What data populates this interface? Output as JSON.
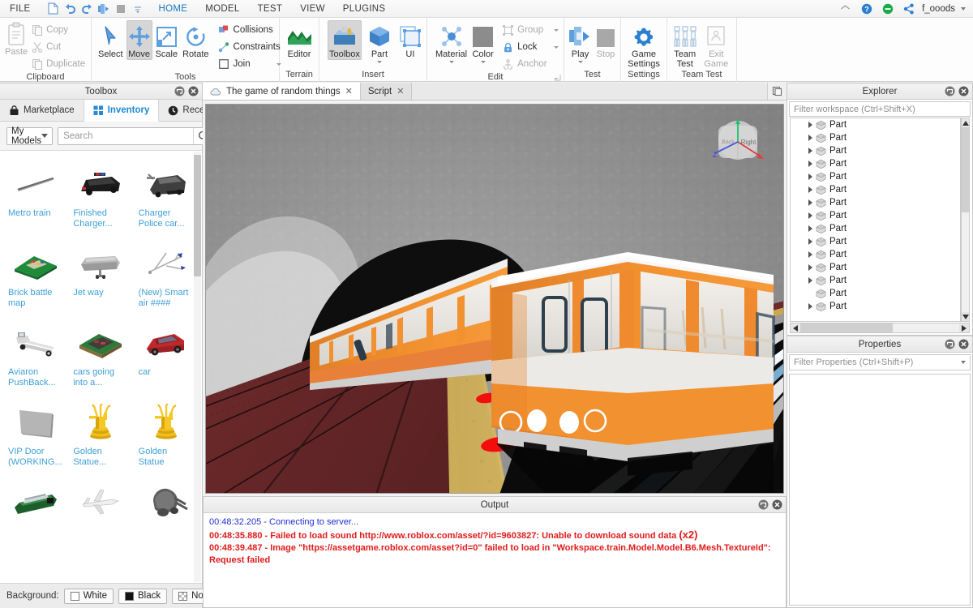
{
  "menubar": {
    "items": [
      {
        "label": "FILE",
        "active": false
      },
      {
        "label": "HOME",
        "active": true
      },
      {
        "label": "MODEL",
        "active": false
      },
      {
        "label": "TEST",
        "active": false
      },
      {
        "label": "VIEW",
        "active": false
      },
      {
        "label": "PLUGINS",
        "active": false
      }
    ],
    "quick_access": [
      "new-file-icon",
      "undo-icon",
      "redo-icon",
      "play-icon",
      "stop-icon",
      "qat-dropdown-icon"
    ],
    "account": {
      "name": "f_ooods",
      "icons": [
        "home-icon",
        "help-icon",
        "notification-icon",
        "share-icon"
      ]
    }
  },
  "ribbon": {
    "groups": [
      {
        "name": "Clipboard",
        "title": "Clipboard",
        "paste": {
          "label": "Paste",
          "disabled": true
        },
        "small": [
          {
            "label": "Copy",
            "icon": "copy-icon",
            "disabled": true
          },
          {
            "label": "Cut",
            "icon": "cut-icon",
            "disabled": true
          },
          {
            "label": "Duplicate",
            "icon": "duplicate-icon",
            "disabled": true
          }
        ]
      },
      {
        "name": "Tools",
        "title": "Tools",
        "buttons": [
          {
            "label": "Select",
            "icon": "cursor-icon",
            "selected": false
          },
          {
            "label": "Move",
            "icon": "move-arrows-icon",
            "selected": true
          },
          {
            "label": "Scale",
            "icon": "scale-icon",
            "selected": false
          },
          {
            "label": "Rotate",
            "icon": "rotate-icon",
            "selected": false
          }
        ],
        "small": [
          {
            "label": "Collisions",
            "icon": "collisions-icon"
          },
          {
            "label": "Constraints",
            "icon": "constraints-icon"
          },
          {
            "label": "Join",
            "icon": "join-checkbox-icon",
            "caret": true
          }
        ]
      },
      {
        "name": "Terrain",
        "title": "Terrain",
        "buttons": [
          {
            "label": "Editor",
            "icon": "terrain-editor-icon",
            "selected": false
          }
        ]
      },
      {
        "name": "Insert",
        "title": "Insert",
        "buttons": [
          {
            "label": "Toolbox",
            "icon": "toolbox-icon",
            "selected": true
          },
          {
            "label": "Part",
            "icon": "part-cube-icon",
            "caret": true
          },
          {
            "label": "UI",
            "icon": "ui-frame-icon"
          }
        ]
      },
      {
        "name": "Edit",
        "title": "Edit",
        "buttons": [
          {
            "label": "Material",
            "icon": "material-icon",
            "caret": true
          },
          {
            "label": "Color",
            "icon": "color-swatch-icon",
            "caret": true
          }
        ],
        "small": [
          {
            "label": "Group",
            "icon": "group-icon",
            "disabled": true,
            "caret": true
          },
          {
            "label": "Lock",
            "icon": "lock-icon",
            "disabled": false,
            "caret": true
          },
          {
            "label": "Anchor",
            "icon": "anchor-icon",
            "disabled": true
          }
        ]
      },
      {
        "name": "Test",
        "title": "Test",
        "buttons": [
          {
            "label": "Play",
            "icon": "play-run-icon",
            "caret": true
          },
          {
            "label": "Stop",
            "icon": "stop-square-icon",
            "disabled": true
          }
        ]
      },
      {
        "name": "Settings",
        "title": "Settings",
        "buttons": [
          {
            "label": "Game",
            "label2": "Settings",
            "icon": "gear-icon"
          }
        ]
      },
      {
        "name": "TeamTest",
        "title": "Team Test",
        "buttons": [
          {
            "label": "Team",
            "label2": "Test",
            "icon": "team-test-icon"
          },
          {
            "label": "Exit",
            "label2": "Game",
            "icon": "exit-game-icon",
            "disabled": true
          }
        ]
      }
    ]
  },
  "toolbox": {
    "title": "Toolbox",
    "tabs": [
      {
        "label": "Marketplace",
        "icon": "bag-icon",
        "active": false
      },
      {
        "label": "Inventory",
        "icon": "grid-icon",
        "active": true
      },
      {
        "label": "Recent",
        "icon": "clock-icon",
        "active": false
      }
    ],
    "category": "My Models",
    "search_placeholder": "Search",
    "search_value": "",
    "items": [
      {
        "name": "Metro train",
        "thumb": "metro-train-thumb"
      },
      {
        "name": "Finished Charger...",
        "thumb": "charger-car-thumb"
      },
      {
        "name": "Charger Police car...",
        "thumb": "police-car-thumb"
      },
      {
        "name": "Brick battle map",
        "thumb": "brick-map-thumb"
      },
      {
        "name": "Jet way",
        "thumb": "jetway-thumb"
      },
      {
        "name": "(New) Smart air ####",
        "thumb": "airplane-thumb"
      },
      {
        "name": "Aviaron PushBack...",
        "thumb": "pushback-thumb"
      },
      {
        "name": "cars going into a...",
        "thumb": "cars-map-thumb"
      },
      {
        "name": "car",
        "thumb": "red-car-thumb"
      },
      {
        "name": "VIP Door (WORKING...",
        "thumb": "vip-door-thumb"
      },
      {
        "name": "Golden Statue...",
        "thumb": "golden-statue-thumb"
      },
      {
        "name": "Golden Statue",
        "thumb": "golden-statue-thumb"
      },
      {
        "name": "",
        "thumb": "train-platform-thumb"
      },
      {
        "name": "",
        "thumb": "white-plane-thumb"
      },
      {
        "name": "",
        "thumb": "gray-blob-thumb"
      }
    ],
    "background": {
      "label": "Background:",
      "options": [
        {
          "label": "White",
          "swatch": "#ffffff"
        },
        {
          "label": "Black",
          "swatch": "#111111"
        },
        {
          "label": "None",
          "swatch": "checker"
        }
      ]
    }
  },
  "viewport": {
    "tabs": [
      {
        "label": "The game of random things",
        "icon": "cloud-icon",
        "active": true,
        "closable": true
      },
      {
        "label": "Script",
        "active": false,
        "closable": true
      }
    ],
    "window_button": "restore-window-icon",
    "nav_gizmo": {
      "face": "Right",
      "axes": [
        "x",
        "y",
        "z"
      ]
    },
    "scene": {
      "description": "Subway tunnel with orange metro train at platform",
      "tunnel_color": "#8d8d8d",
      "platform_color": "#6b2a2a",
      "platform_edge_color": "#c9a84f",
      "train_body_color": "#f08a2e",
      "marker_color": "#f40d0d"
    }
  },
  "output": {
    "title": "Output",
    "lines": [
      {
        "text": "00:48:32.205 - Connecting to server...",
        "type": "info",
        "suffix": ""
      },
      {
        "text": "00:48:35.880 - Failed to load sound http://www.roblox.com/asset/?id=9603827: Unable to download sound data ",
        "type": "error",
        "suffix": "(x2)"
      },
      {
        "text": "00:48:39.487 - Image \"https://assetgame.roblox.com/asset?id=0\" failed to load in \"Workspace.train.Model.Model.B6.Mesh.TextureId\": Request failed",
        "type": "error",
        "suffix": ""
      }
    ]
  },
  "explorer": {
    "title": "Explorer",
    "filter_placeholder": "Filter workspace (Ctrl+Shift+X)",
    "nodes": [
      {
        "label": "Part",
        "expandable": true
      },
      {
        "label": "Part",
        "expandable": true
      },
      {
        "label": "Part",
        "expandable": true
      },
      {
        "label": "Part",
        "expandable": true
      },
      {
        "label": "Part",
        "expandable": true
      },
      {
        "label": "Part",
        "expandable": true
      },
      {
        "label": "Part",
        "expandable": true
      },
      {
        "label": "Part",
        "expandable": true
      },
      {
        "label": "Part",
        "expandable": true
      },
      {
        "label": "Part",
        "expandable": true
      },
      {
        "label": "Part",
        "expandable": true
      },
      {
        "label": "Part",
        "expandable": true
      },
      {
        "label": "Part",
        "expandable": true
      },
      {
        "label": "Part",
        "expandable": false
      },
      {
        "label": "Part",
        "expandable": true
      }
    ]
  },
  "properties": {
    "title": "Properties",
    "filter_placeholder": "Filter Properties (Ctrl+Shift+P)"
  },
  "colors": {
    "accent_blue": "#1a8ad4",
    "ribbon_blue": "#4b8fd8",
    "error_red": "#e01b1b",
    "info_blue": "#1e2fd0",
    "link_blue": "#3d9fd6"
  }
}
